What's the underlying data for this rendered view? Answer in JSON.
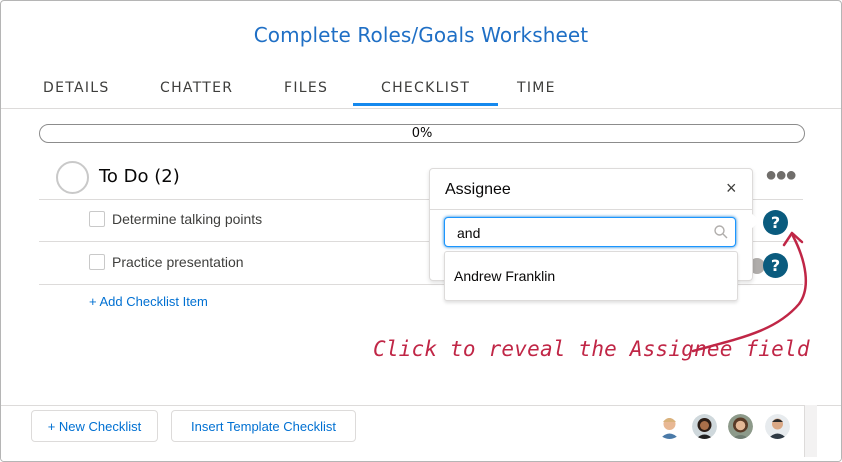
{
  "header": {
    "title": "Complete Roles/Goals Worksheet"
  },
  "tabs": [
    {
      "label": "DETAILS"
    },
    {
      "label": "CHATTER"
    },
    {
      "label": "FILES"
    },
    {
      "label": "CHECKLIST"
    },
    {
      "label": "TIME"
    }
  ],
  "active_tab": "CHECKLIST",
  "progress": {
    "label": "0%",
    "value": 0
  },
  "checklist": {
    "title": "To Do (2)",
    "more_icon": "more-options-icon",
    "items": [
      {
        "label": "Determine talking points"
      },
      {
        "label": "Practice presentation"
      }
    ],
    "add_item_label": "+ Add Checklist Item"
  },
  "help_badge": {
    "label": "?"
  },
  "assignee_popover": {
    "title": "Assignee",
    "close_label": "×",
    "search_value": "and",
    "result": "Andrew Franklin"
  },
  "annotation": {
    "text": "Click to reveal the Assignee field"
  },
  "footer": {
    "new_checklist_label": "+ New Checklist",
    "insert_template_label": "Insert Template Checklist"
  },
  "colors": {
    "accent": "#1589ee",
    "link": "#0070d2",
    "help_badge": "#0a5b7e",
    "annotation": "#c02646"
  }
}
